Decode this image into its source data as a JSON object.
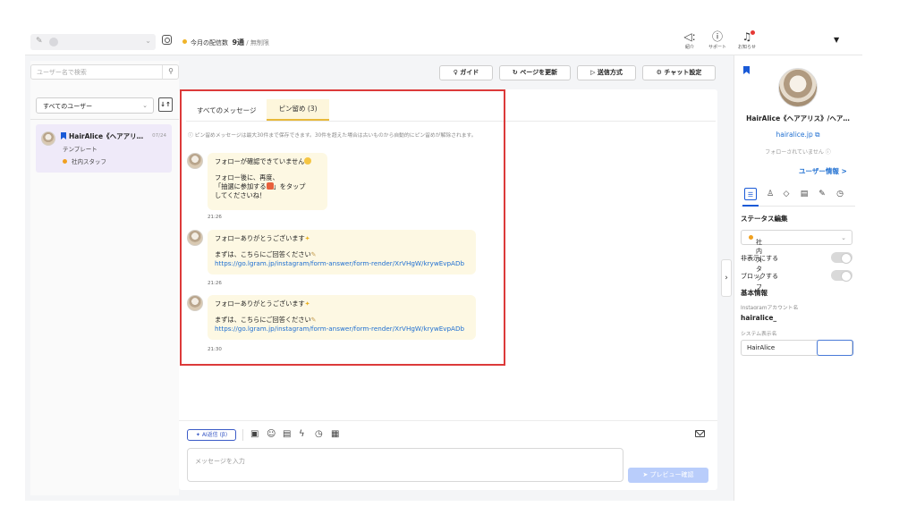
{
  "header": {
    "quota_label": "今月の配信数",
    "quota_value": "9通",
    "quota_limit": "/ 無制限",
    "icons": [
      {
        "icon": "speaker-icon",
        "label": "紹介"
      },
      {
        "icon": "help-icon",
        "label": "サポート"
      },
      {
        "icon": "bell-icon",
        "label": "お知らせ"
      }
    ]
  },
  "sidebar": {
    "search_placeholder": "ユーザー名で検索",
    "filter_value": "すべてのユーザー",
    "user": {
      "name": "HairAlice《ヘアアリ…",
      "date": "07/24",
      "subtitle": "テンプレート",
      "tag": "社内スタッフ"
    }
  },
  "toolbar": {
    "guide": "ガイド",
    "refresh": "ページを更新",
    "send_mode": "送信方式",
    "chat_settings": "チャット設定"
  },
  "tabs": {
    "all": "すべてのメッセージ",
    "pinned": "ピン留め (3)"
  },
  "notice": "ピン留めメッセージは最大30件まで保存できます。30件を超えた場合は古いものから自動的にピン留めが解除されます。",
  "messages": [
    {
      "line1": "フォローが確認できていません",
      "line2": "フォロー後に、再度、",
      "line3": "「抽選に参加する",
      "line3b": "」をタップ",
      "line4": "してくださいね！",
      "time": "21:26"
    },
    {
      "line1": "フォローありがとうございます",
      "line2": "まずは、こちらにご回答ください",
      "link": "https://go.lgram.jp/instagram/form-answer/form-render/XrVHgW/krywEvpADb",
      "time": "21:26"
    },
    {
      "line1": "フォローありがとうございます",
      "line2": "まずは、こちらにご回答ください",
      "link": "https://go.lgram.jp/instagram/form-answer/form-render/XrVHgW/krywEvpADb",
      "time": "21:30"
    }
  ],
  "composer": {
    "ai_label": "AI返信 (β)",
    "placeholder": "メッセージを入力",
    "preview_label": "プレビュー確認"
  },
  "profile": {
    "name": "HairAlice《ヘアアリス》/ヘア…",
    "link": "hairalice.jp",
    "follow_status": "フォローされていません",
    "info_link": "ユーザー情報 >",
    "status_heading": "ステータス編集",
    "status_value": "社内スタッフ",
    "hide_label": "非表示にする",
    "block_label": "ブロックする",
    "basic_heading": "基本情報",
    "ig_account_label": "Instagramアカウント名",
    "ig_account_value": "hairalice_",
    "display_name_label": "システム表示名",
    "display_name_value": "HairAlice"
  },
  "colors": {
    "accent": "#1a5ad7",
    "highlight_border": "#dc3a3a",
    "bubble": "#fdf8e3",
    "tab_active": "#fdf6dc"
  }
}
